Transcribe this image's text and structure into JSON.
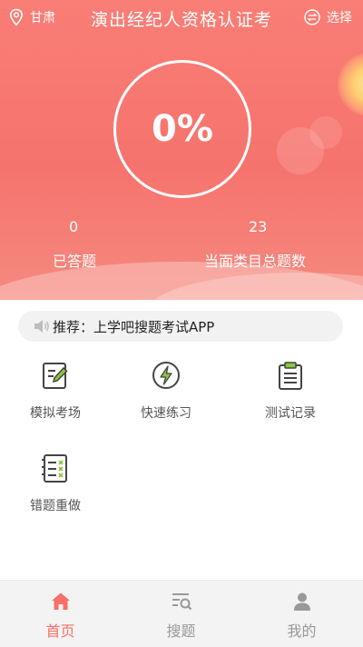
{
  "colors": {
    "accent": "#f6746d",
    "tab_active": "#f57068",
    "tab_inactive": "#999999",
    "icon_dark": "#444444"
  },
  "header": {
    "location": "甘肃",
    "title": "演出经纪人资格认证考",
    "select_label": "选择"
  },
  "progress": {
    "percent_text": "0%",
    "percent": 0
  },
  "stats": [
    {
      "value": "0",
      "label": "已答题"
    },
    {
      "value": "23",
      "label": "当面类目总题数"
    }
  ],
  "notice": {
    "text": "推荐：上学吧搜题考试APP",
    "icon": "speaker-icon"
  },
  "menu": [
    {
      "label": "模拟考场",
      "icon": "edit-icon"
    },
    {
      "label": "快速练习",
      "icon": "lightning-icon"
    },
    {
      "label": "测试记录",
      "icon": "clipboard-icon"
    },
    {
      "label": "错题重做",
      "icon": "checklist-icon"
    }
  ],
  "tabs": [
    {
      "label": "首页",
      "icon": "home-icon",
      "active": true
    },
    {
      "label": "搜题",
      "icon": "search-list-icon",
      "active": false
    },
    {
      "label": "我的",
      "icon": "user-icon",
      "active": false
    }
  ]
}
